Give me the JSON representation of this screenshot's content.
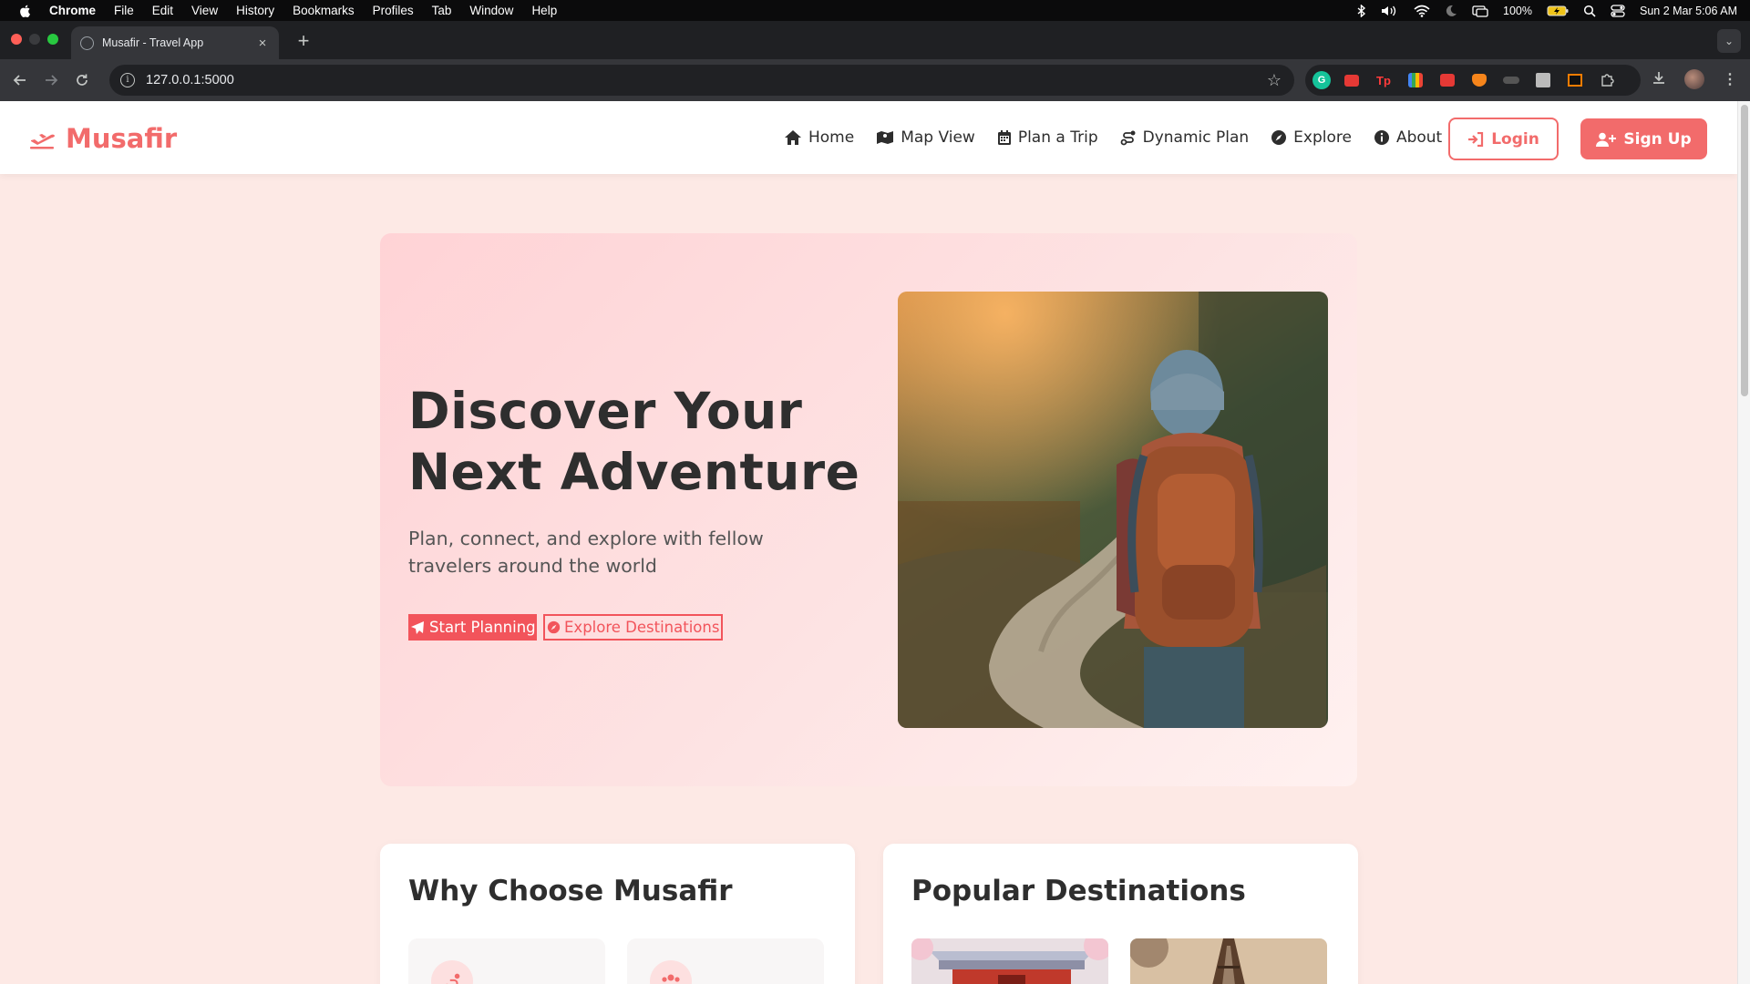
{
  "menubar": {
    "app": "Chrome",
    "items": [
      "File",
      "Edit",
      "View",
      "History",
      "Bookmarks",
      "Profiles",
      "Tab",
      "Window",
      "Help"
    ],
    "battery": "100%",
    "datetime": "Sun 2 Mar  5:06 AM"
  },
  "browser": {
    "tab_title": "Musafir - Travel App",
    "url": "127.0.0.1:5000"
  },
  "site": {
    "brand": "Musafir",
    "nav": {
      "home": "Home",
      "map_view": "Map View",
      "plan_trip": "Plan a Trip",
      "dynamic_plan": "Dynamic Plan",
      "explore": "Explore",
      "about": "About"
    },
    "login": "Login",
    "signup": "Sign Up",
    "accent_color": "#f26b6b"
  },
  "hero": {
    "title_line1": "Discover Your",
    "title_line2": "Next Adventure",
    "subtitle": "Plan, connect, and explore with fellow travelers around the world",
    "cta_primary": "Start Planning",
    "cta_secondary": "Explore Destinations"
  },
  "sections": {
    "why_title": "Why Choose Musafir",
    "popular_title": "Popular Destinations"
  }
}
